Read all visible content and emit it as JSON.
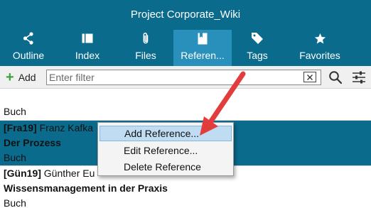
{
  "window": {
    "title": "Project Corporate_Wiki"
  },
  "tabs": [
    {
      "label": "Outline",
      "icon": "share-icon"
    },
    {
      "label": "Index",
      "icon": "index-icon"
    },
    {
      "label": "Files",
      "icon": "paperclip-icon"
    },
    {
      "label": "Referen...",
      "icon": "book-icon",
      "active": true
    },
    {
      "label": "Tags",
      "icon": "tag-icon"
    },
    {
      "label": "Favorites",
      "icon": "star-icon"
    }
  ],
  "toolbar": {
    "add_label": "Add",
    "filter_placeholder": "Enter filter"
  },
  "references": [
    {
      "key": "",
      "author": "",
      "title": "",
      "type": "Buch"
    },
    {
      "key": "[Fra19]",
      "author": "Franz Kafka",
      "title": "Der Prozess",
      "type": "Buch",
      "selected": true
    },
    {
      "key": "[Gün19]",
      "author": "Günther Eu",
      "title": "Wissensmanagement  in der Praxis",
      "type": "Buch"
    }
  ],
  "context_menu": {
    "items": [
      {
        "label": "Add Reference...",
        "highlighted": true
      },
      {
        "label": "Edit Reference..."
      },
      {
        "label": "Delete Reference"
      }
    ]
  },
  "colors": {
    "header": "#0a6b8d",
    "active_tab": "#2990bb",
    "selection": "#0a6b8d",
    "menu_highlight": "#bfdcf2",
    "annotation_arrow": "#e23c3c",
    "add_icon": "#3aa63a"
  }
}
